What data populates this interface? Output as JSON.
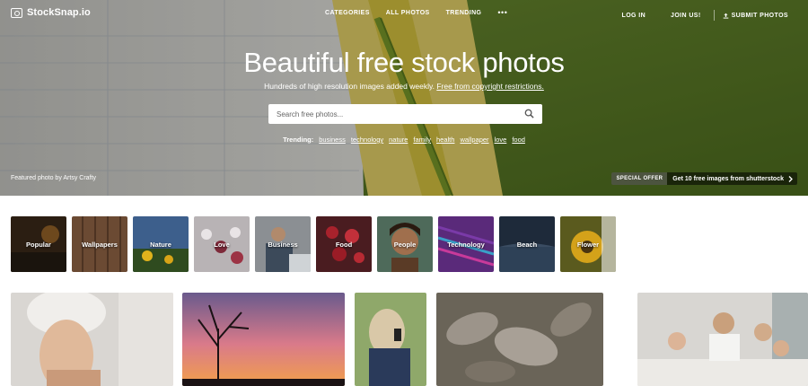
{
  "brand": {
    "name": "StockSnap.io"
  },
  "nav": {
    "center": [
      "CATEGORIES",
      "ALL PHOTOS",
      "TRENDING"
    ],
    "more": "•••",
    "login": "LOG IN",
    "join": "JOIN US!",
    "submit": "SUBMIT PHOTOS"
  },
  "hero": {
    "title": "Beautiful free stock photos",
    "subtitle_plain": "Hundreds of high resolution images added weekly.",
    "subtitle_link": "Free from copyright restrictions.",
    "search_placeholder": "Search free photos...",
    "trending_label": "Trending:",
    "trending_tags": [
      "business",
      "technology",
      "nature",
      "family",
      "health",
      "wallpaper",
      "love",
      "food"
    ],
    "credit_prefix": "Featured photo by",
    "credit_name": "Artsy Crafty",
    "offer_badge": "SPECIAL OFFER",
    "offer_text": "Get 10 free images from shutterstock"
  },
  "categories": [
    "Popular",
    "Wallpapers",
    "Nature",
    "Love",
    "Business",
    "Food",
    "People",
    "Technology",
    "Beach",
    "Flower"
  ],
  "photos": [
    {
      "alt": "woman with towel on head"
    },
    {
      "alt": "tree silhouette at sunset"
    },
    {
      "alt": "woman holding phone"
    },
    {
      "alt": "frosted leaves"
    },
    {
      "alt": "family in bed"
    }
  ],
  "icons": {
    "logo": "camera-icon",
    "search": "search-icon",
    "submit": "upload-icon",
    "offer": "chevron-right-icon"
  }
}
